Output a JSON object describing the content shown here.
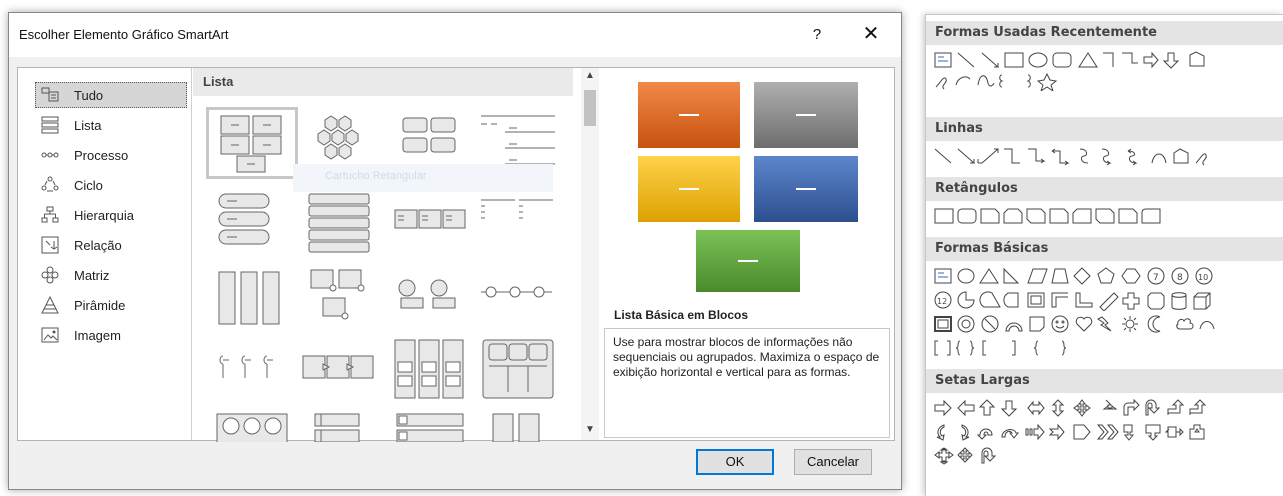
{
  "dialog": {
    "title": "Escolher Elemento Gráfico SmartArt",
    "help": "?",
    "close": "✕",
    "categories": [
      {
        "label": "Tudo",
        "icon": "all-icon",
        "selected": true
      },
      {
        "label": "Lista",
        "icon": "list-icon"
      },
      {
        "label": "Processo",
        "icon": "process-icon"
      },
      {
        "label": "Ciclo",
        "icon": "cycle-icon"
      },
      {
        "label": "Hierarquia",
        "icon": "hierarchy-icon"
      },
      {
        "label": "Relação",
        "icon": "relationship-icon"
      },
      {
        "label": "Matriz",
        "icon": "matrix-icon"
      },
      {
        "label": "Pirâmide",
        "icon": "pyramid-icon"
      },
      {
        "label": "Imagem",
        "icon": "picture-icon"
      }
    ],
    "gallery": {
      "header": "Lista",
      "tooltip": "Cartucho Retangular"
    },
    "preview": {
      "name": "Lista Básica em Blocos",
      "description": "Use para mostrar blocos de informações não sequenciais ou agrupados. Maximiza o espaço de exibição horizontal e vertical para as formas.",
      "colors": [
        "#e06a1e",
        "#8a8a8a",
        "#f2b400",
        "#3c62a8",
        "#5aa33a"
      ]
    },
    "ok_label": "OK",
    "cancel_label": "Cancelar"
  },
  "shapes_panel": {
    "sections": [
      {
        "title": "Formas Usadas Recentemente"
      },
      {
        "title": "Linhas"
      },
      {
        "title": "Retângulos"
      },
      {
        "title": "Formas Básicas"
      },
      {
        "title": "Setas Largas"
      }
    ]
  }
}
